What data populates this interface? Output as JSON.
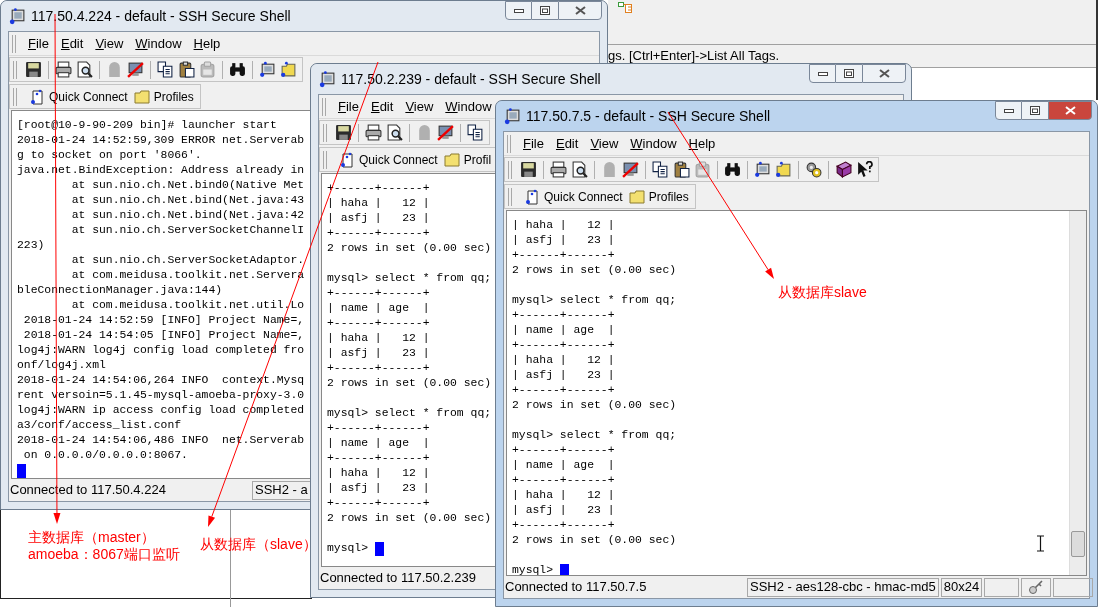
{
  "background": {
    "hint_text": "gs. [Ctrl+Enter]->List All Tags."
  },
  "windows": [
    {
      "title": "117.50.4.224 - default - SSH Secure Shell",
      "active": false,
      "menu": [
        "File",
        "Edit",
        "View",
        "Window",
        "Help"
      ],
      "toolbar": [
        [
          {
            "kind": "save",
            "disabled": false
          }
        ],
        [
          {
            "kind": "print",
            "disabled": false
          },
          {
            "kind": "preview",
            "disabled": false
          }
        ],
        [
          {
            "kind": "connect",
            "disabled": true
          },
          {
            "kind": "disconnect",
            "disabled": false
          }
        ],
        [
          {
            "kind": "copy",
            "disabled": false
          },
          {
            "kind": "paste",
            "disabled": false
          },
          {
            "kind": "clear",
            "disabled": true
          }
        ],
        [
          {
            "kind": "find",
            "disabled": false
          }
        ],
        [
          {
            "kind": "new_terminal",
            "disabled": false
          },
          {
            "kind": "new_transfer",
            "disabled": false
          }
        ]
      ],
      "quick_connect": "Quick Connect",
      "profiles": "Profiles",
      "terminal": [
        {
          "lines": [
            "[root@10-9-90-209 bin]# launcher start",
            "2018-01-24 14:52:59,309 ERROR net.Serverab",
            "g to socket on port '8066'.",
            "java.net.BindException: Address already in",
            "        at sun.nio.ch.Net.bind0(Native Met",
            "        at sun.nio.ch.Net.bind(Net.java:43",
            "        at sun.nio.ch.Net.bind(Net.java:42",
            "        at sun.nio.ch.ServerSocketChannelI",
            "223)",
            "        at sun.nio.ch.ServerSocketAdaptor.",
            "        at com.meidusa.toolkit.net.Servera",
            "bleConnectionManager.java:144)",
            "        at com.meidusa.toolkit.net.util.Lo",
            " 2018-01-24 14:52:59 [INFO] Project Name=,",
            " 2018-01-24 14:54:05 [INFO] Project Name=,",
            "log4j:WARN log4j config load completed fro",
            "onf/log4j.xml",
            "2018-01-24 14:54:06,264 INFO  context.Mysq",
            "rent versoin=5.1.45-mysql-amoeba-proxy-3.0",
            "log4j:WARN ip access config load completed",
            "a3/conf/access_list.conf",
            "2018-01-24 14:54:06,486 INFO  net.Serverab",
            " on 0.0.0.0/0.0.0.0:8067."
          ],
          "input": {
            "cursor": true
          }
        }
      ],
      "status_bar": [
        {
          "kind": "text",
          "text": "Connected to 117.50.4.224"
        },
        {
          "kind": "text",
          "text": "SSH2 - a"
        }
      ]
    },
    {
      "title": "117.50.2.239 - default - SSH Secure Shell",
      "active": false,
      "menu": [
        "File",
        "Edit",
        "View",
        "Window"
      ],
      "toolbar": [
        [
          {
            "kind": "save",
            "disabled": false
          }
        ],
        [
          {
            "kind": "print",
            "disabled": false
          },
          {
            "kind": "preview",
            "disabled": false
          }
        ],
        [
          {
            "kind": "connect",
            "disabled": true
          },
          {
            "kind": "disconnect",
            "disabled": false
          }
        ],
        [
          {
            "kind": "copy",
            "disabled": false
          }
        ]
      ],
      "quick_connect": "Quick Connect",
      "profiles": "Profil",
      "terminal": [
        {
          "lines": [
            "+------+------+",
            "| haha |   12 |",
            "| asfj |   23 |",
            "+------+------+",
            "2 rows in set (0.00 sec)"
          ]
        },
        {
          "lines": [
            "mysql> select * from qq;",
            "+------+------+",
            "| name | age  |",
            "+------+------+",
            "| haha |   12 |",
            "| asfj |   23 |",
            "+------+------+",
            "2 rows in set (0.00 sec)"
          ]
        },
        {
          "lines": [
            "mysql> select * from qq;",
            "+------+------+",
            "| name | age  |",
            "+------+------+",
            "| haha |   12 |",
            "| asfj |   23 |",
            "+------+------+",
            "2 rows in set (0.00 sec)"
          ]
        },
        {
          "input": {
            "prompt": "mysql>",
            "cursor": true
          }
        }
      ],
      "status_bar": [
        {
          "kind": "text",
          "text": "Connected to 117.50.2.239"
        }
      ]
    },
    {
      "title": "117.50.7.5 - default - SSH Secure Shell",
      "active": true,
      "menu": [
        "File",
        "Edit",
        "View",
        "Window",
        "Help"
      ],
      "toolbar": [
        [
          {
            "kind": "save",
            "disabled": false
          }
        ],
        [
          {
            "kind": "print",
            "disabled": false
          },
          {
            "kind": "preview",
            "disabled": false
          }
        ],
        [
          {
            "kind": "connect",
            "disabled": true
          },
          {
            "kind": "disconnect",
            "disabled": false
          }
        ],
        [
          {
            "kind": "copy",
            "disabled": false
          },
          {
            "kind": "paste",
            "disabled": false
          },
          {
            "kind": "clear",
            "disabled": true
          }
        ],
        [
          {
            "kind": "find",
            "disabled": false
          }
        ],
        [
          {
            "kind": "new_terminal",
            "disabled": false
          },
          {
            "kind": "new_transfer",
            "disabled": false
          }
        ],
        [
          {
            "kind": "settings",
            "disabled": false
          }
        ],
        [
          {
            "kind": "help",
            "disabled": false
          },
          {
            "kind": "context_help",
            "disabled": false
          }
        ]
      ],
      "quick_connect": "Quick Connect",
      "profiles": "Profiles",
      "terminal": [
        {
          "lines": [
            "| haha |   12 |",
            "| asfj |   23 |",
            "+------+------+",
            "2 rows in set (0.00 sec)"
          ]
        },
        {
          "lines": [
            "mysql> select * from qq;",
            "+------+------+",
            "| name | age  |",
            "+------+------+",
            "| haha |   12 |",
            "| asfj |   23 |",
            "+------+------+",
            "2 rows in set (0.00 sec)"
          ]
        },
        {
          "lines": [
            "mysql> select * from qq;",
            "+------+------+",
            "| name | age  |",
            "+------+------+",
            "| haha |   12 |",
            "| asfj |   23 |",
            "+------+------+",
            "2 rows in set (0.00 sec)"
          ]
        },
        {
          "input": {
            "prompt": "mysql>",
            "cursor": true
          }
        }
      ],
      "status_bar": [
        {
          "kind": "text",
          "text": "Connected to 117.50.7.5"
        },
        {
          "kind": "text",
          "text": "SSH2 - aes128-cbc - hmac-md5"
        },
        {
          "kind": "text",
          "text": "80x24"
        },
        {
          "kind": "blank"
        },
        {
          "kind": "icon"
        },
        {
          "kind": "blank"
        }
      ]
    }
  ],
  "annotations": [
    {
      "text": "主数据库（master）"
    },
    {
      "text": "amoeba：8067端口监听"
    },
    {
      "text": "从数据库（slave）"
    },
    {
      "text": "从数据库slave"
    }
  ]
}
